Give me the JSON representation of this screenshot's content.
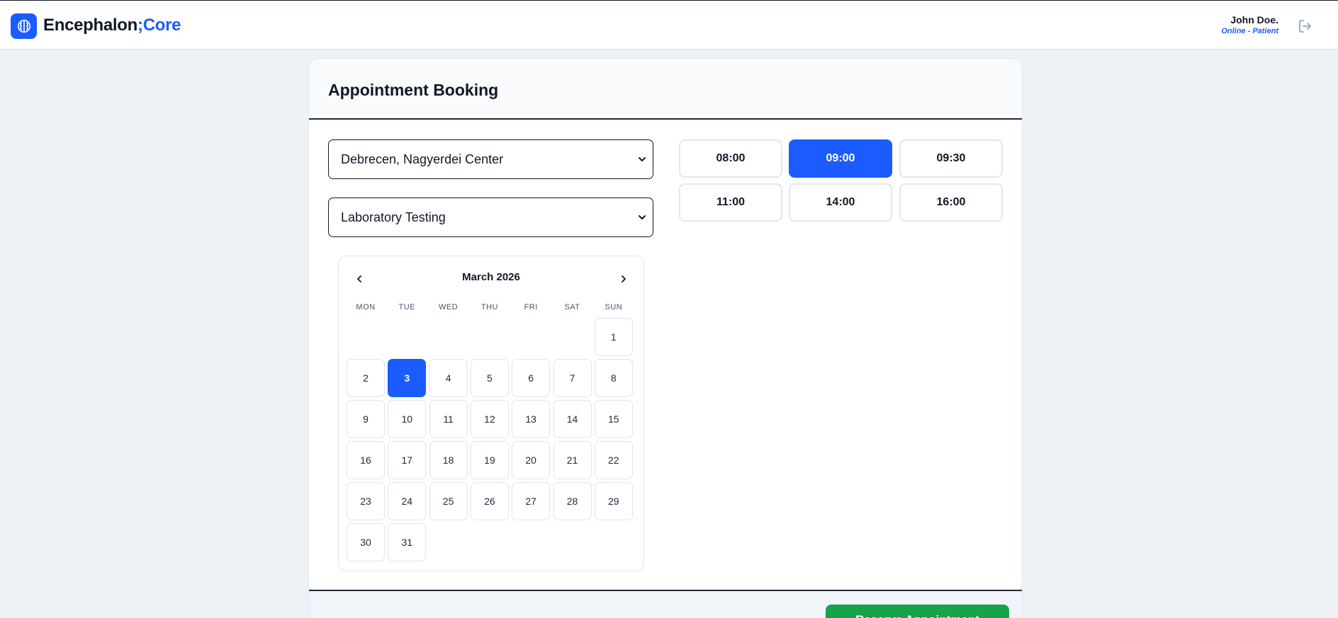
{
  "header": {
    "brand_part1": "Encephalon",
    "brand_part2": ";Core",
    "user_name": "John Doe.",
    "user_role": "Online - Patient",
    "brand_color": "#1a5cff"
  },
  "booking": {
    "title": "Appointment Booking",
    "location_select": "Debrecen, Nagyerdei Center",
    "service_select": "Laboratory Testing",
    "confirm_label": "Reserve Appointment"
  },
  "calendar": {
    "month_label": "March 2026",
    "weekdays": [
      "MON",
      "TUE",
      "WED",
      "THU",
      "FRI",
      "SAT",
      "SUN"
    ],
    "first_weekday_index": 6,
    "days_in_month": 31,
    "selected_day": 3
  },
  "slots": {
    "times": [
      "08:00",
      "09:00",
      "09:30",
      "11:00",
      "14:00",
      "16:00"
    ],
    "selected": "09:00"
  },
  "colors": {
    "accent": "#1a5cff",
    "confirm": "#16a34a"
  }
}
